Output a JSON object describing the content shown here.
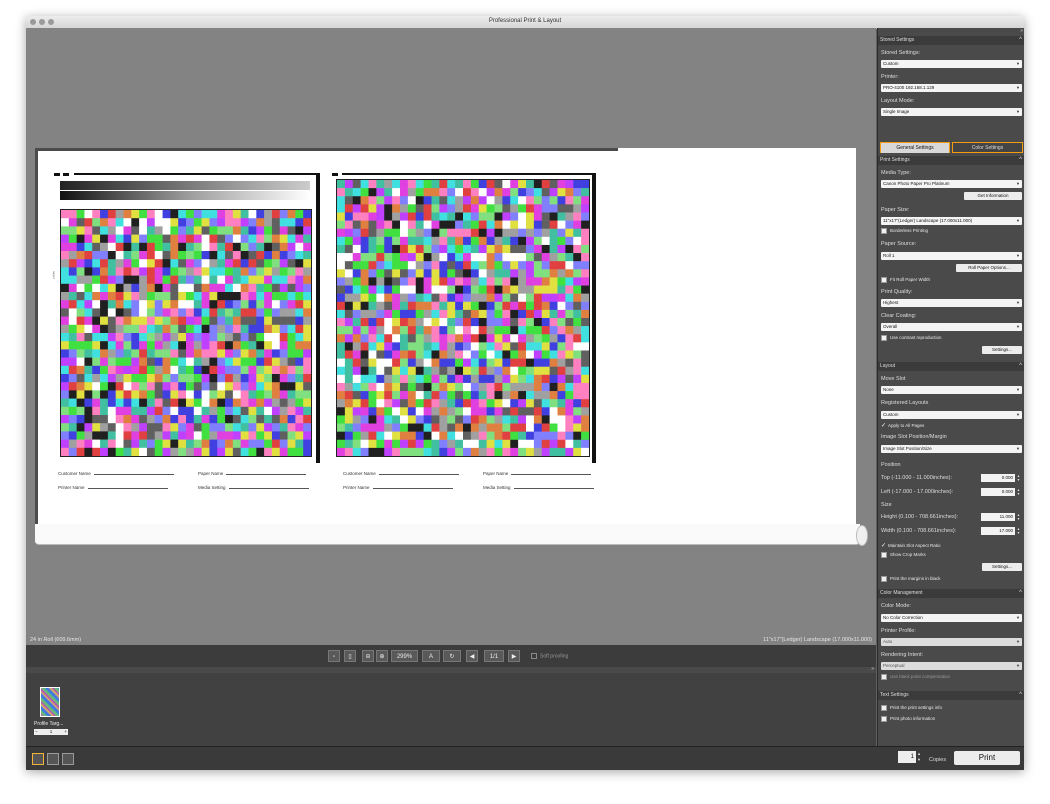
{
  "window": {
    "title": "Professional Print & Layout"
  },
  "canvas": {
    "roll_info": "24 in Roll (609.6mm)",
    "paper_info": "11\"x17\"(Ledger) Landscape (17.000x11.000)",
    "sheet1": {
      "customer_label": "Customer Name",
      "paper_label": "Paper Name",
      "printer_label": "Printer Name",
      "media_label": "Media Setting"
    },
    "sheet2": {
      "customer_label": "Customer Name",
      "paper_label": "Paper Name",
      "printer_label": "Printer Name",
      "media_label": "Media Setting"
    }
  },
  "toolbar": {
    "zoom": "299%",
    "page": "1/1",
    "soft_proofing": "Soft proofing"
  },
  "thumbnails": [
    {
      "label": "Profile Targ...",
      "count": "1"
    }
  ],
  "copies": {
    "value": "1",
    "label": "Copies"
  },
  "print_button": "Print",
  "panel": {
    "stored": {
      "header": "Stored Settings",
      "stored_label": "Stored Settings:",
      "stored_value": "Custom",
      "printer_label": "Printer:",
      "printer_value": "PRO-4100 192.168.1.129",
      "layout_label": "Layout Mode:",
      "layout_value": "Single Image"
    },
    "tabs": {
      "general": "General Settings",
      "color": "Color Settings"
    },
    "print_settings": {
      "header": "Print Settings",
      "media_label": "Media Type:",
      "media_value": "Canon Photo Paper Pro Platinum",
      "get_info": "Get Information",
      "size_label": "Paper Size:",
      "size_value": "11\"x17\"(Ledger) Landscape (17.000x11.000)",
      "borderless": "Borderless Printing",
      "source_label": "Paper Source:",
      "source_value": "Roll 1",
      "roll_options": "Roll Paper Options...",
      "fit_roll": "Fit Roll Paper Width",
      "quality_label": "Print Quality:",
      "quality_value": "Highest",
      "coating_label": "Clear Coating:",
      "coating_value": "Overall",
      "contrast": "Use contrast reproduction",
      "settings": "Settings..."
    },
    "layout": {
      "header": "Layout",
      "move_label": "Move Slot",
      "move_value": "None",
      "registered_label": "Registered Layouts",
      "registered_value": "Custom",
      "apply_all": "Apply to All Pages",
      "slot_label": "Image Slot Position/Margin",
      "slot_value": "Image Slot Position/Size",
      "position_label": "Position",
      "top_label": "Top (-11.000 - 11.000inches):",
      "top_value": "0.000",
      "left_label": "Left (-17.000 - 17.000inches):",
      "left_value": "0.000",
      "size_label": "Size",
      "height_label": "Height (0.100 - 708.661inches):",
      "height_value": "11.000",
      "width_label": "Width (0.100 - 708.661inches):",
      "width_value": "17.000",
      "maintain": "Maintain Slot Aspect Ratio",
      "crop": "Show Crop Marks",
      "settings": "Settings...",
      "margins_black": "Print the margins in black"
    },
    "color": {
      "header": "Color Management",
      "mode_label": "Color Mode:",
      "mode_value": "No Color Correction",
      "profile_label": "Printer Profile:",
      "profile_value": "Auto",
      "intent_label": "Rendering Intent:",
      "intent_value": "Perceptual",
      "bpc": "Use black point compensation"
    },
    "text": {
      "header": "Text Settings",
      "print_info": "Print the print settings info",
      "photo_info": "Print photo information"
    }
  }
}
